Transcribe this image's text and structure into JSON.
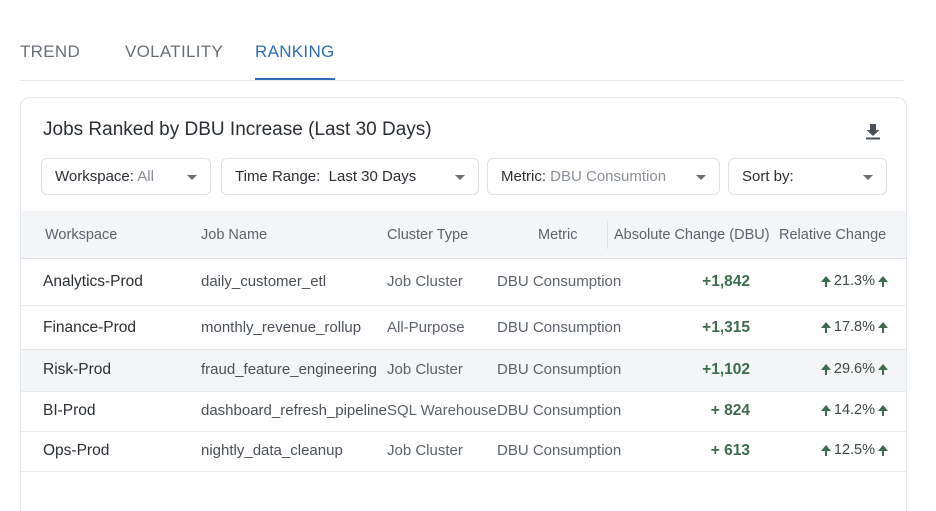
{
  "tabs": [
    {
      "label": "TREND"
    },
    {
      "label": "VOLATILITY"
    },
    {
      "label": "RANKING"
    }
  ],
  "active_tab": "RANKING",
  "accent_color": "#2f6db5",
  "positive_color": "#3d6b4e",
  "card": {
    "title": "Jobs Ranked by DBU Increase (Last 30 Days)",
    "download_icon": "download-icon"
  },
  "filters": {
    "workspace": {
      "label": "Workspace:",
      "value": "All"
    },
    "time_range": {
      "label": "Time Range:",
      "value": "Last 30 Days"
    },
    "metric": {
      "label": "Metric:",
      "value": "DBU Consumtion"
    },
    "sort_by": {
      "label": "Sort by:",
      "value": ""
    }
  },
  "table": {
    "columns": [
      "Workspace",
      "Job Name",
      "Cluster Type",
      "Metric",
      "Absolute Change (DBU)",
      "Relative Change"
    ],
    "rows": [
      {
        "workspace": "Analytics-Prod",
        "job": "daily_customer_etl",
        "cluster": "Job Cluster",
        "metric": "DBU Consumption",
        "abs": "+1,842",
        "rel": "21.3%"
      },
      {
        "workspace": "Finance-Prod",
        "job": "monthly_revenue_rollup",
        "cluster": "All-Purpose",
        "metric": "DBU Consumption",
        "abs": "+1,315",
        "rel": "17.8%"
      },
      {
        "workspace": "Risk-Prod",
        "job": "fraud_feature_engineering",
        "cluster": "Job Cluster",
        "metric": "DBU Consumption",
        "abs": "+1,102",
        "rel": "29.6%"
      },
      {
        "workspace": "BI-Prod",
        "job": "dashboard_refresh_pipeline",
        "cluster": "SQL Warehouse",
        "metric": "DBU Consumption",
        "abs": "+ 824",
        "rel": "14.2%"
      },
      {
        "workspace": "Ops-Prod",
        "job": "nightly_data_cleanup",
        "cluster": "Job Cluster",
        "metric": "DBU Consumption",
        "abs": "+ 613",
        "rel": "12.5%"
      }
    ]
  }
}
